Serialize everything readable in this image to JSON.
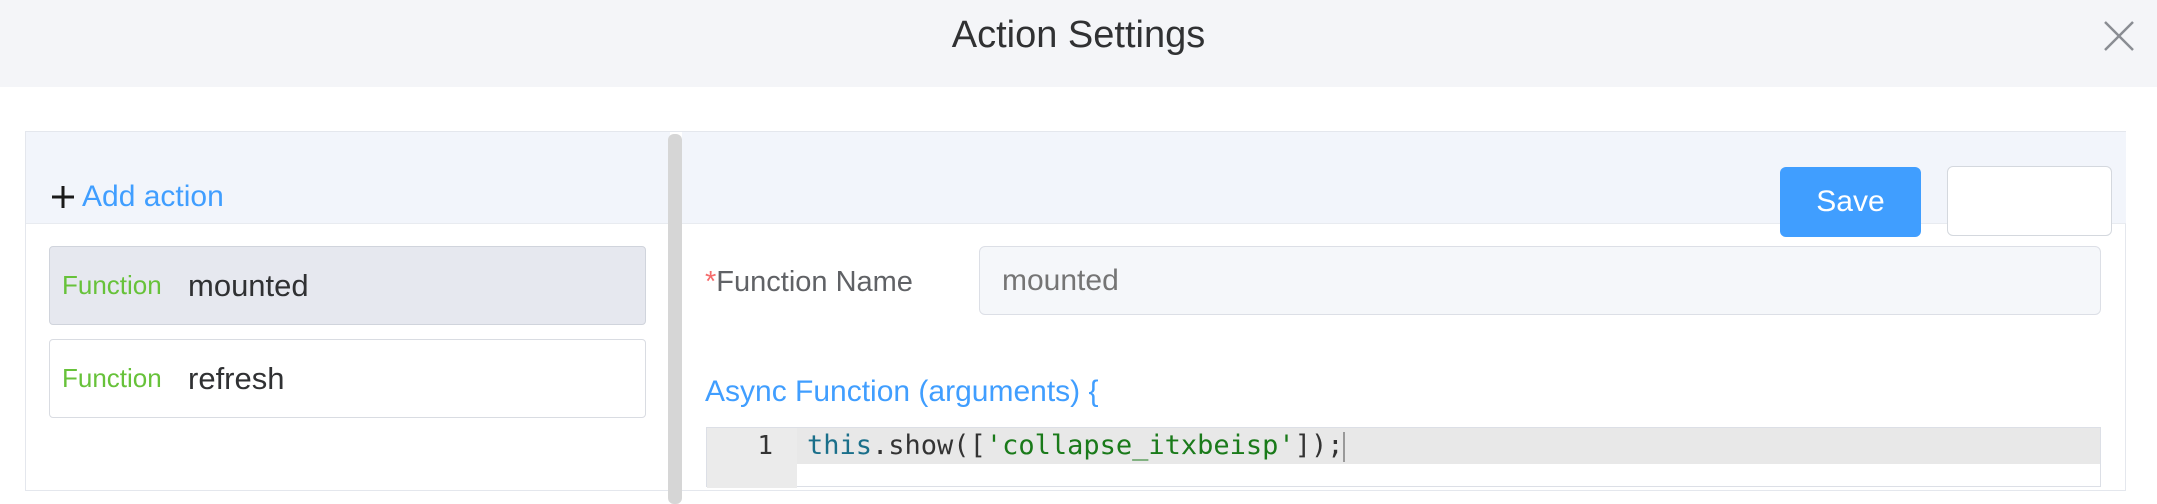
{
  "dialog": {
    "title": "Action Settings",
    "close_icon": "close-icon"
  },
  "sidebar": {
    "add_action_label": "Add action",
    "add_icon": "plus-icon",
    "items": [
      {
        "type": "Function",
        "name": "mounted",
        "active": true
      },
      {
        "type": "Function",
        "name": "refresh",
        "active": false
      }
    ]
  },
  "toolbar": {
    "save_label": "Save",
    "secondary_label": ""
  },
  "form": {
    "required_mark": "*",
    "function_name_label": "Function Name",
    "function_name_placeholder": "mounted",
    "async_label": "Async Function (arguments) {"
  },
  "editor": {
    "line_number": "1",
    "code": {
      "keyword": "this",
      "pre": ".show([",
      "string": "'collapse_itxbeisp'",
      "post": "]);"
    }
  },
  "colors": {
    "accent": "#409eff",
    "function_tag": "#67c23a",
    "required": "#f56c6c"
  }
}
